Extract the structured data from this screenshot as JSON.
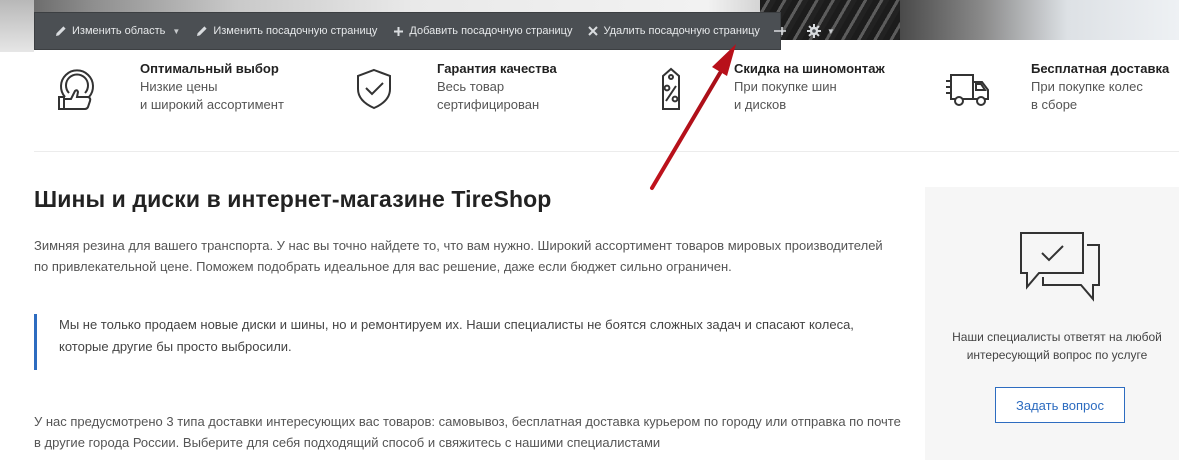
{
  "toolbar": {
    "items": [
      {
        "label": "Изменить область",
        "icon": "pencil-icon",
        "has_dropdown": true
      },
      {
        "label": "Изменить посадочную страницу",
        "icon": "pencil-icon",
        "has_dropdown": false
      },
      {
        "label": "Добавить посадочную страницу",
        "icon": "plus-icon",
        "has_dropdown": false
      },
      {
        "label": "Удалить посадочную страницу",
        "icon": "cross-icon",
        "has_dropdown": false
      }
    ],
    "pin_icon": "pin-icon",
    "settings_icon": "gear-icon"
  },
  "features": [
    {
      "icon": "thumbs-up-icon",
      "title": "Оптимальный выбор",
      "subtitle": "Низкие цены\nи широкий ассортимент"
    },
    {
      "icon": "shield-check-icon",
      "title": "Гарантия качества",
      "subtitle": "Весь товар\nсертифицирован"
    },
    {
      "icon": "discount-tag-icon",
      "title": "Скидка на шиномонтаж",
      "subtitle": "При покупке шин\nи дисков"
    },
    {
      "icon": "truck-icon",
      "title": "Бесплатная доставка",
      "subtitle": "При покупке колес\nв сборе"
    }
  ],
  "main": {
    "title": "Шины и диски в интернет-магазине TireShop",
    "paragraph1": "Зимняя резина для вашего транспорта. У нас вы точно найдете то, что вам нужно. Широкий ассортимент товаров мировых производителей по привлекательной цене. Поможем подобрать идеальное для вас решение, даже если бюджет сильно ограничен.",
    "quote": "Мы не только продаем новые диски и шины, но и ремонтируем их. Наши специалисты не боятся сложных задач и спасают колеса, которые другие бы просто выбросили.",
    "paragraph3": "У нас предусмотрено 3 типа доставки интересующих вас товаров: самовывоз, бесплатная доставка курьером по городу или  отправка по почте в другие города России. Выберите для себя подходящий способ и свяжитесь с нашими специалистами"
  },
  "card": {
    "icon": "chat-bubbles-icon",
    "text": "Наши специалисты ответят на любой\nинтересующий вопрос по услуге",
    "button_label": "Задать вопрос"
  },
  "colors": {
    "accent": "#2d6cc0",
    "toolbar_bg": "#4b4f53",
    "annotation_arrow": "#c0121c"
  }
}
